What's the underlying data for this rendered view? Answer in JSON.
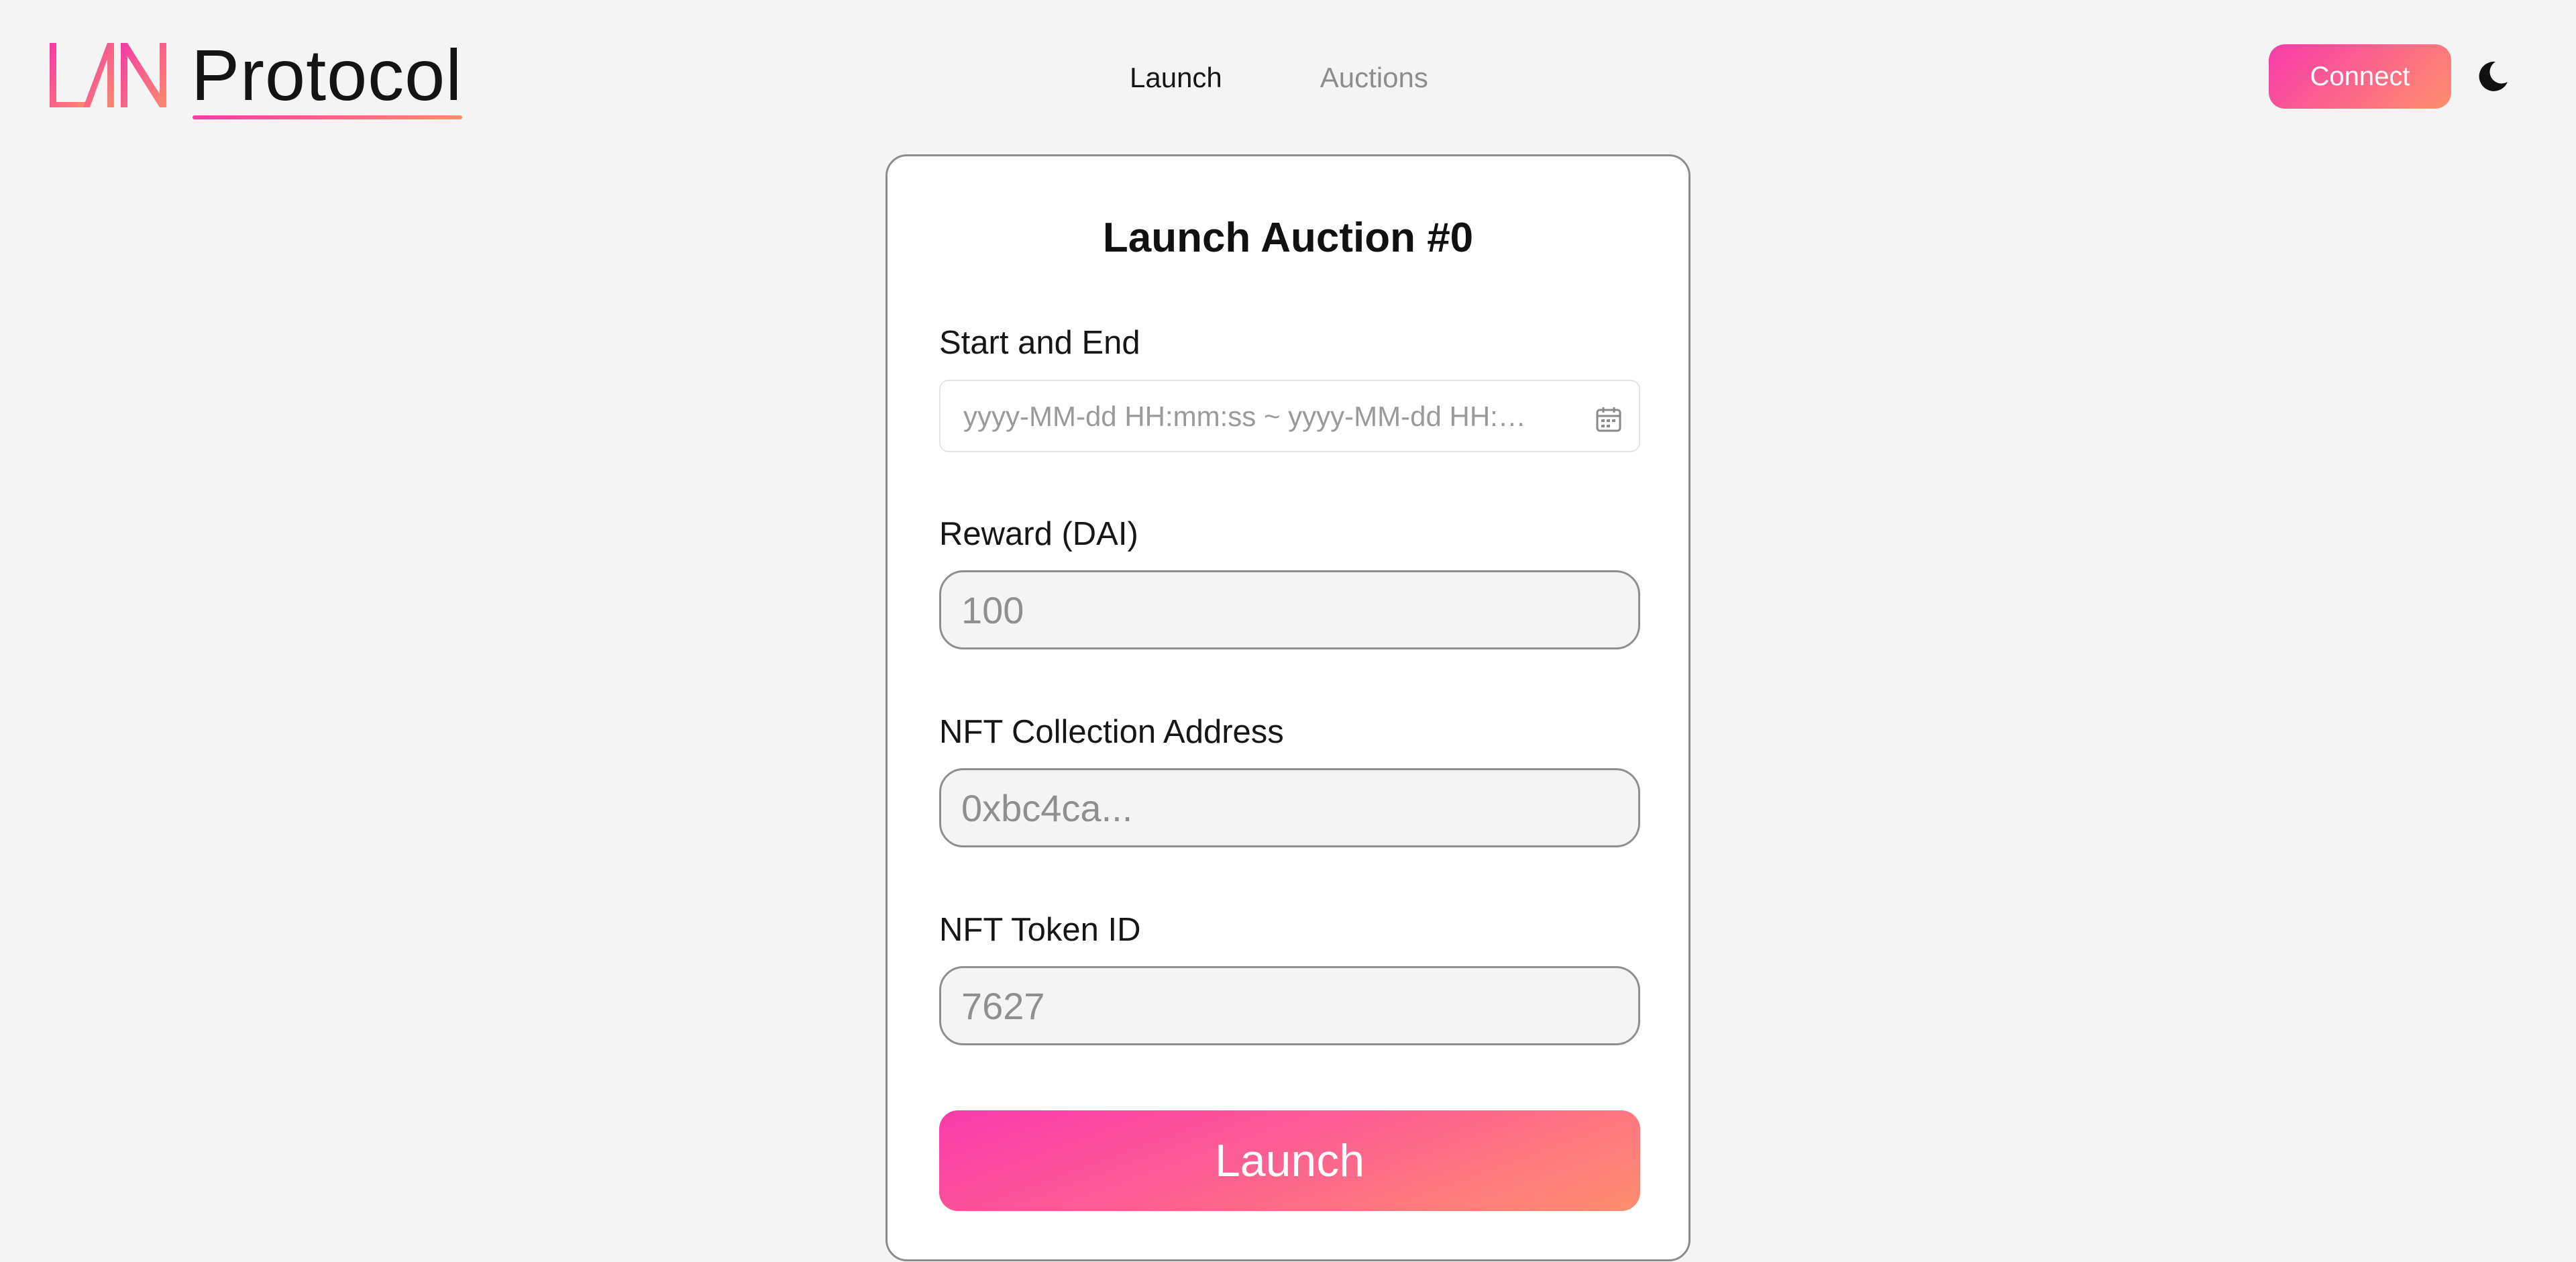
{
  "brand": {
    "logo_text": "LAN",
    "name": "Protocol",
    "gradient_start": "#f43ba6",
    "gradient_end": "#fe8a6c"
  },
  "nav": {
    "items": [
      {
        "label": "Launch",
        "active": true
      },
      {
        "label": "Auctions",
        "active": false
      }
    ]
  },
  "header": {
    "connect_label": "Connect",
    "theme_icon": "moon-icon"
  },
  "form": {
    "title": "Launch Auction #0",
    "start_end": {
      "label": "Start and End",
      "placeholder": "yyyy-MM-dd HH:mm:ss ~ yyyy-MM-dd HH:mm:ss",
      "icon": "calendar-icon"
    },
    "reward": {
      "label": "Reward (DAI)",
      "placeholder": "100",
      "value": ""
    },
    "nft_collection": {
      "label": "NFT Collection Address",
      "placeholder": "0xbc4ca...",
      "value": ""
    },
    "nft_token_id": {
      "label": "NFT Token ID",
      "placeholder": "7627",
      "value": ""
    },
    "submit_label": "Launch"
  },
  "colors": {
    "background": "#f4f4f4",
    "card": "#ffffff",
    "accent_pink": "#f73ba9",
    "accent_orange": "#fe8f6d",
    "muted_text": "#8d8d8d"
  }
}
